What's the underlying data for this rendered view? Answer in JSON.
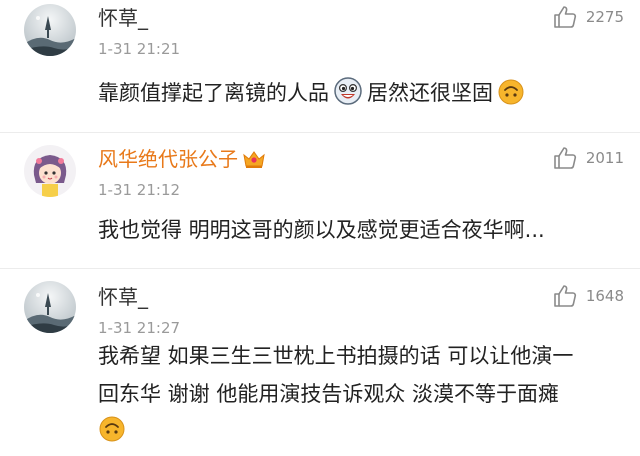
{
  "comments": [
    {
      "username": "怀草_",
      "time": "1-31 21:21",
      "likes": "2275",
      "text_a": "靠颜值撑起了离镜的人品",
      "text_b": "居然还很坚固",
      "avatar_icon": "landscape-avatar",
      "emojis": [
        "laughing-face-emoji",
        "upside-down-smile-emoji"
      ]
    },
    {
      "username": "风华绝代张公子",
      "time": "1-31 21:12",
      "likes": "2011",
      "text": "我也觉得 明明这哥的颜以及感觉更适合夜华啊...",
      "avatar_icon": "cartoon-girl-avatar",
      "badge_icon": "vip-crown-icon",
      "name_color": "#e8791a"
    },
    {
      "username": "怀草_",
      "time": "1-31 21:27",
      "likes": "1648",
      "line1": "我希望 如果三生三世枕上书拍摄的话 可以让他演一",
      "line2": "回东华 谢谢  他能用演技告诉观众 淡漠不等于面瘫",
      "avatar_icon": "landscape-avatar",
      "emojis": [
        "upside-down-smile-emoji"
      ]
    }
  ],
  "colors": {
    "text": "#222222",
    "meta": "#9a9a9a",
    "vip_name": "#e8791a",
    "emoji_yellow": "#f7b52c"
  }
}
